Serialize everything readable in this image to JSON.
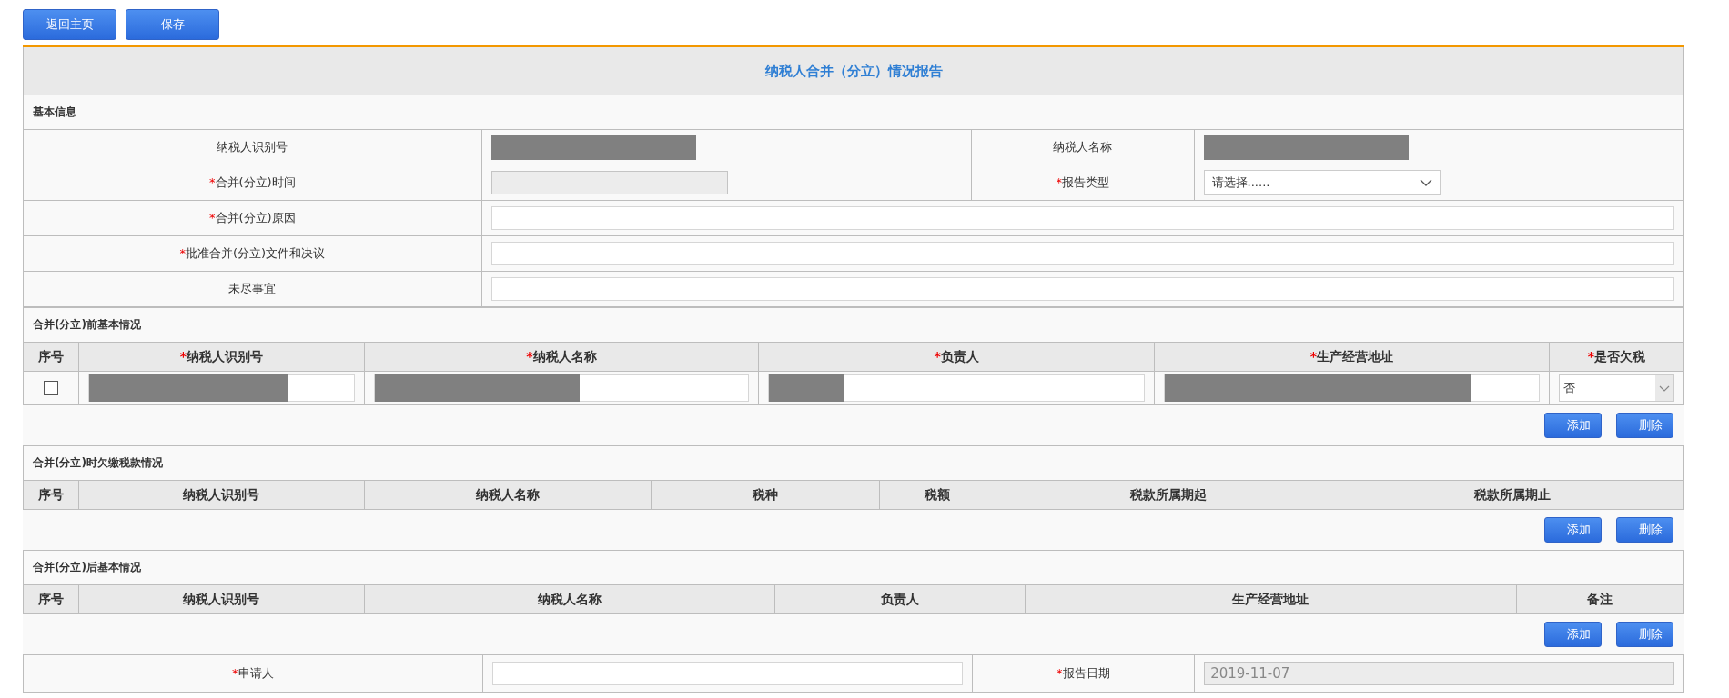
{
  "toolbar": [
    "返回主页",
    "保存"
  ],
  "title": "纳税人合并（分立）情况报告",
  "basic_info": {
    "heading": "基本信息",
    "rows": [
      [
        {
          "label": "纳税人识别号",
          "field": {
            "kind": "redacted"
          }
        },
        {
          "label": "纳税人名称",
          "field": {
            "kind": "redacted"
          }
        }
      ],
      [
        {
          "mark": "*",
          "label": "合并(分立)时间",
          "field": {
            "kind": "input",
            "disabled": true
          }
        },
        {
          "mark": "*",
          "label": "报告类型",
          "field": {
            "kind": "select",
            "value": "请选择......"
          }
        }
      ],
      [
        {
          "mark": "*",
          "label": "合并(分立)原因",
          "field": {
            "kind": "input",
            "disabled": false
          }
        }
      ],
      [
        {
          "mark": "*",
          "label": "批准合并(分立)文件和决议",
          "field": {
            "kind": "input",
            "disabled": false
          }
        }
      ],
      [
        {
          "label": "未尽事宜",
          "field": {
            "kind": "input",
            "disabled": false
          }
        }
      ]
    ]
  },
  "tables": [
    {
      "heading": "合并(分立)前基本情况",
      "columns": [
        {
          "label": "序号"
        },
        {
          "mark": "*",
          "label": "纳税人识别号"
        },
        {
          "mark": "*",
          "label": "纳税人名称"
        },
        {
          "mark": "*",
          "label": "负责人"
        },
        {
          "mark": "*",
          "label": "生产经营地址"
        },
        {
          "mark": "*",
          "label": "是否欠税"
        }
      ],
      "rows": [
        [
          {
            "kind": "checkbox",
            "checked": false
          },
          {
            "kind": "redacted"
          },
          {
            "kind": "redacted"
          },
          {
            "kind": "redacted"
          },
          {
            "kind": "redacted"
          },
          {
            "kind": "select",
            "value": "否"
          }
        ]
      ],
      "actions": [
        "添加",
        "删除"
      ]
    },
    {
      "heading": "合并(分立)时欠缴税款情况",
      "columns": [
        {
          "label": "序号"
        },
        {
          "label": "纳税人识别号"
        },
        {
          "label": "纳税人名称"
        },
        {
          "label": "税种"
        },
        {
          "label": "税额"
        },
        {
          "label": "税款所属期起"
        },
        {
          "label": "税款所属期止"
        }
      ],
      "actions": [
        "添加",
        "删除"
      ]
    },
    {
      "heading": "合并(分立)后基本情况",
      "columns": [
        {
          "label": "序号"
        },
        {
          "label": "纳税人识别号"
        },
        {
          "label": "纳税人名称"
        },
        {
          "label": "负责人"
        },
        {
          "label": "生产经营地址"
        },
        {
          "label": "备注"
        }
      ],
      "actions": [
        "添加",
        "删除"
      ]
    }
  ],
  "footer_row": [
    {
      "mark": "*",
      "label": "申请人",
      "field": {
        "kind": "input",
        "disabled": false
      }
    },
    {
      "mark": "*",
      "label": "报告日期",
      "field": {
        "kind": "input",
        "value": "2019-11-07",
        "disabled": true
      }
    }
  ]
}
